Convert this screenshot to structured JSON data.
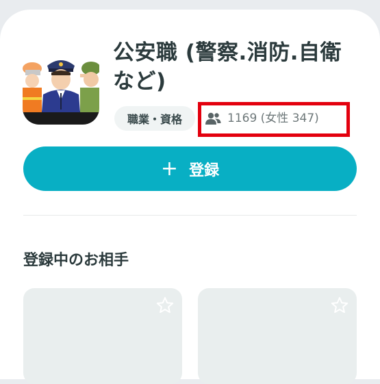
{
  "group": {
    "title": "公安職 (警察.消防.自衛など)",
    "category_tag": "職業・資格",
    "members_text": "1169 (女性 347)",
    "members_icon": "people-icon"
  },
  "register_button": {
    "icon": "+",
    "label": "登録"
  },
  "section": {
    "title": "登録中のお相手"
  },
  "cards": [
    {
      "icon": "star-outline-icon"
    },
    {
      "icon": "star-outline-icon"
    }
  ],
  "colors": {
    "accent": "#08afc4",
    "highlight_box": "#e3000e",
    "card_bg": "#e9eeee",
    "title_text": "#2b3a3c"
  }
}
